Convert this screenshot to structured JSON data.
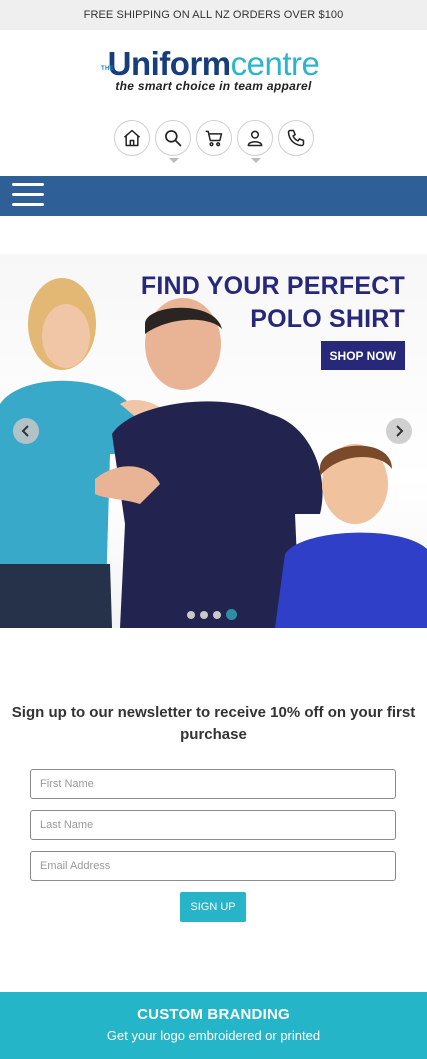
{
  "topbar": {
    "text": "FREE SHIPPING ON ALL NZ ORDERS OVER $100"
  },
  "logo": {
    "the": "THE",
    "uniform": "Uniform",
    "centre": "centre",
    "tagline": "the smart choice in team apparel"
  },
  "header_icons": [
    "home-icon",
    "search-icon",
    "cart-icon",
    "user-icon",
    "phone-icon"
  ],
  "hero": {
    "title_line1": "FIND YOUR PERFECT",
    "title_line2": "POLO SHIRT",
    "button": "SHOP NOW",
    "slides": 4,
    "active_slide": 4
  },
  "newsletter": {
    "title": "Sign up to our newsletter to receive 10% off on your first purchase",
    "first_name_placeholder": "First Name",
    "last_name_placeholder": "Last Name",
    "email_placeholder": "Email Address",
    "button": "SIGN UP"
  },
  "branding": {
    "title": "CUSTOM BRANDING",
    "subtitle": "Get your logo embroidered or printed"
  },
  "colors": {
    "navbar": "#2e5f96",
    "logo_dark": "#173d7a",
    "logo_light": "#2bb5cc",
    "hero_text": "#27287a",
    "accent": "#24b5c9"
  }
}
